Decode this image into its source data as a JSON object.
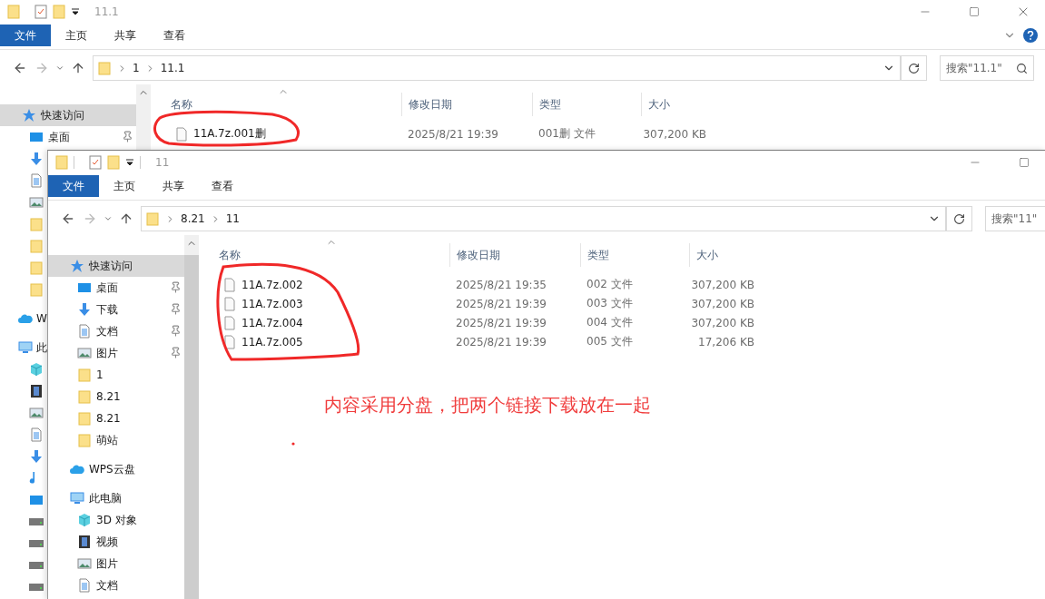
{
  "windows": [
    {
      "title": "11.1",
      "file_menu": "文件",
      "tabs": [
        "主页",
        "共享",
        "查看"
      ],
      "path": [
        "1",
        "11.1"
      ],
      "search": {
        "placeholder": "搜索\"11.1\""
      },
      "sidebar": [
        {
          "kind": "star",
          "label": "快速访问",
          "selected": true,
          "children": [
            {
              "kind": "desktop",
              "label": "桌面",
              "pinned": true
            },
            {
              "kind": "download"
            },
            {
              "kind": "doc"
            },
            {
              "kind": "picture"
            },
            {
              "kind": "folder"
            },
            {
              "kind": "folder"
            },
            {
              "kind": "folder"
            },
            {
              "kind": "folder"
            }
          ]
        },
        {
          "kind": "cloud",
          "label": "W",
          "selected": false
        },
        {
          "kind": "computer",
          "label": "此",
          "selected": false,
          "children": [
            {
              "kind": "cube"
            },
            {
              "kind": "video"
            },
            {
              "kind": "picture"
            },
            {
              "kind": "doc"
            },
            {
              "kind": "download"
            },
            {
              "kind": "music"
            },
            {
              "kind": "desktop"
            },
            {
              "kind": "drive"
            },
            {
              "kind": "drive"
            },
            {
              "kind": "drive"
            },
            {
              "kind": "drive"
            }
          ]
        }
      ],
      "columns": [
        "名称",
        "修改日期",
        "类型",
        "大小"
      ],
      "files": [
        {
          "name": "11A.7z.001删",
          "modified": "2025/8/21 19:39",
          "type": "001删 文件",
          "size": "307,200 KB"
        }
      ]
    },
    {
      "title": "11",
      "file_menu": "文件",
      "tabs": [
        "主页",
        "共享",
        "查看"
      ],
      "path": [
        "8.21",
        "11"
      ],
      "search": {
        "placeholder": "搜索\"11\""
      },
      "sidebar": [
        {
          "kind": "star",
          "label": "快速访问",
          "selected": true,
          "children": [
            {
              "kind": "desktop",
              "label": "桌面",
              "pinned": true
            },
            {
              "kind": "download",
              "label": "下载",
              "pinned": true
            },
            {
              "kind": "doc",
              "label": "文档",
              "pinned": true
            },
            {
              "kind": "picture",
              "label": "图片",
              "pinned": true
            },
            {
              "kind": "folder",
              "label": "1",
              "pinned": false
            },
            {
              "kind": "folder",
              "label": "8.21",
              "pinned": false
            },
            {
              "kind": "folder",
              "label": "8.21",
              "pinned": false
            },
            {
              "kind": "folder",
              "label": "萌站",
              "pinned": false
            }
          ]
        },
        {
          "kind": "cloud",
          "label": "WPS云盘",
          "selected": false
        },
        {
          "kind": "computer",
          "label": "此电脑",
          "selected": false,
          "children": [
            {
              "kind": "cube",
              "label": "3D 对象"
            },
            {
              "kind": "video",
              "label": "视频"
            },
            {
              "kind": "picture",
              "label": "图片"
            },
            {
              "kind": "doc",
              "label": "文档"
            }
          ]
        }
      ],
      "columns": [
        "名称",
        "修改日期",
        "类型",
        "大小"
      ],
      "files": [
        {
          "name": "11A.7z.002",
          "modified": "2025/8/21 19:35",
          "type": "002 文件",
          "size": "307,200 KB"
        },
        {
          "name": "11A.7z.003",
          "modified": "2025/8/21 19:39",
          "type": "003 文件",
          "size": "307,200 KB"
        },
        {
          "name": "11A.7z.004",
          "modified": "2025/8/21 19:39",
          "type": "004 文件",
          "size": "307,200 KB"
        },
        {
          "name": "11A.7z.005",
          "modified": "2025/8/21 19:39",
          "type": "005 文件",
          "size": "17,206 KB"
        }
      ]
    }
  ],
  "annotation": {
    "note": "内容采用分盘，把两个链接下载放在一起"
  }
}
